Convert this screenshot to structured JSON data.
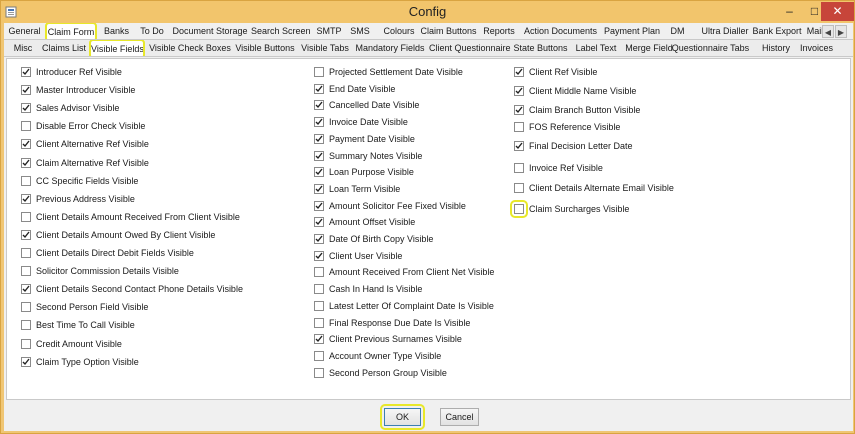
{
  "window": {
    "title": "Config",
    "minimize_glyph": "–",
    "maximize_glyph": "□",
    "close_glyph": "✕"
  },
  "tabs_row1": [
    {
      "label": "General"
    },
    {
      "label": "Claim Form",
      "active": true,
      "highlighted": true
    },
    {
      "label": "Banks"
    },
    {
      "label": "To Do"
    },
    {
      "label": "Document Storage"
    },
    {
      "label": "Search Screen"
    },
    {
      "label": "SMTP"
    },
    {
      "label": "SMS"
    },
    {
      "label": "Colours"
    },
    {
      "label": "Claim Buttons"
    },
    {
      "label": "Reports"
    },
    {
      "label": "Action Documents"
    },
    {
      "label": "Payment Plan"
    },
    {
      "label": "DM"
    },
    {
      "label": "Ultra Dialler"
    },
    {
      "label": "Bank Export"
    },
    {
      "label": "Mail"
    }
  ],
  "tabs_row2": [
    {
      "label": "Misc"
    },
    {
      "label": "Claims List"
    },
    {
      "label": "Visible Fields",
      "active": true,
      "highlighted": true
    },
    {
      "label": "Visible Check Boxes"
    },
    {
      "label": "Visible Buttons"
    },
    {
      "label": "Visible Tabs"
    },
    {
      "label": "Mandatory Fields"
    },
    {
      "label": "Client Questionnaire"
    },
    {
      "label": "State Buttons"
    },
    {
      "label": "Label Text"
    },
    {
      "label": "Merge Field"
    },
    {
      "label": "Questionnaire Tabs"
    },
    {
      "label": "History"
    },
    {
      "label": "Invoices"
    }
  ],
  "tab_scroll": {
    "left": "◀",
    "right": "▶"
  },
  "checkboxes": {
    "col1": [
      {
        "label": "Introducer Ref Visible",
        "checked": true
      },
      {
        "label": "Master Introducer Visible",
        "checked": true
      },
      {
        "label": "Sales Advisor Visible",
        "checked": true
      },
      {
        "label": "Disable Error Check Visible",
        "checked": false
      },
      {
        "label": "Client Alternative Ref Visible",
        "checked": true
      },
      {
        "label": "Claim Alternative Ref Visible",
        "checked": true
      },
      {
        "label": "CC Specific Fields Visible",
        "checked": false
      },
      {
        "label": "Previous Address Visible",
        "checked": true
      },
      {
        "label": "Client Details Amount Received From Client Visible",
        "checked": false
      },
      {
        "label": "Client Details Amount Owed By Client Visible",
        "checked": true
      },
      {
        "label": "Client Details Direct Debit Fields Visible",
        "checked": false
      },
      {
        "label": "Solicitor Commission Details Visible",
        "checked": false
      },
      {
        "label": "Client Details Second Contact Phone Details Visible",
        "checked": true
      },
      {
        "label": "Second Person Field Visible",
        "checked": false
      },
      {
        "label": "Best Time To Call Visible",
        "checked": false
      },
      {
        "label": "Credit Amount Visible",
        "checked": false
      },
      {
        "label": "Claim Type Option Visible",
        "checked": true
      }
    ],
    "col2": [
      {
        "label": "Projected Settlement Date Visible",
        "checked": false
      },
      {
        "label": "End Date Visible",
        "checked": true
      },
      {
        "label": "Cancelled Date Visible",
        "checked": true
      },
      {
        "label": " Invoice Date Visible",
        "checked": true
      },
      {
        "label": "Payment Date Visible",
        "checked": true
      },
      {
        "label": "Summary Notes Visible",
        "checked": true
      },
      {
        "label": "Loan Purpose Visible",
        "checked": true
      },
      {
        "label": "Loan Term Visible",
        "checked": true
      },
      {
        "label": "Amount Solicitor Fee Fixed Visible",
        "checked": true
      },
      {
        "label": "Amount Offset Visible",
        "checked": true
      },
      {
        "label": "Date Of Birth Copy Visible",
        "checked": true
      },
      {
        "label": "Client User Visible",
        "checked": true
      },
      {
        "label": "Amount Received From Client Net Visible",
        "checked": false
      },
      {
        "label": "Cash In Hand Is Visible",
        "checked": false
      },
      {
        "label": "Latest Letter Of Complaint Date Is Visible",
        "checked": false
      },
      {
        "label": "Final Response Due Date Is Visible",
        "checked": false
      },
      {
        "label": "Client Previous Surnames Visible",
        "checked": true
      },
      {
        "label": "Account Owner Type Visible",
        "checked": false
      },
      {
        "label": "Second Person Group Visible",
        "checked": false
      }
    ],
    "col3": [
      {
        "label": "Client Ref Visible",
        "checked": true
      },
      {
        "label": "Client Middle Name Visible",
        "checked": true
      },
      {
        "label": "Claim Branch Button Visible",
        "checked": true
      },
      {
        "label": "FOS Reference Visible",
        "checked": false
      },
      {
        "label": "Final Decision Letter Date",
        "checked": true
      },
      {
        "label": "Invoice Ref Visible",
        "checked": false
      },
      {
        "label": "Client Details Alternate Email Visible",
        "checked": false
      },
      {
        "label": "Claim Surcharges Visible",
        "checked": false,
        "highlighted": true
      }
    ]
  },
  "buttons": {
    "ok_label": "OK",
    "cancel_label": "Cancel"
  },
  "colors": {
    "titlebar": "#f2c56c",
    "highlight": "#e8e82a",
    "close_button": "#c7453a"
  }
}
